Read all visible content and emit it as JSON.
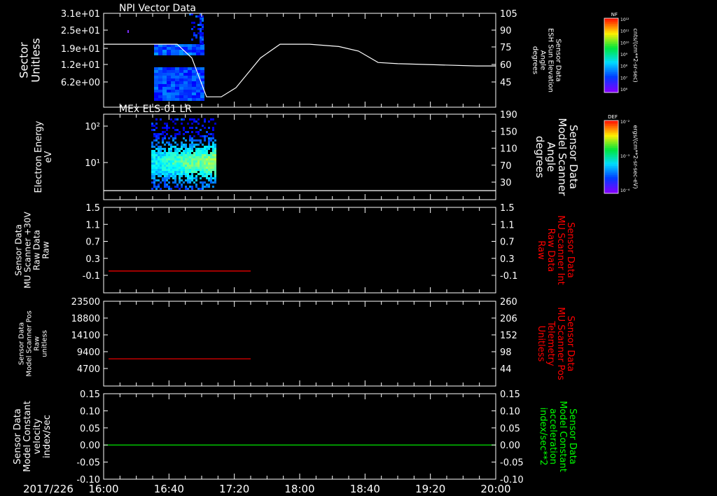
{
  "time_axis": {
    "date": "2017/226",
    "ticks": [
      "16:00",
      "16:40",
      "17:20",
      "18:00",
      "18:40",
      "19:20",
      "20:00"
    ],
    "range_hours": [
      16.0,
      20.0
    ]
  },
  "colorbars": [
    {
      "tag": "NF",
      "unit": "cnts/(cm**2-sr-sec)",
      "ticks": [
        "10¹²",
        "10¹¹",
        "10¹⁰",
        "10⁹",
        "10⁸",
        "10⁷",
        "10⁶"
      ],
      "scale": "log"
    },
    {
      "tag": "DEF",
      "unit": "ergs/(cm**2-sr-sec-eV)",
      "ticks": [
        "10⁻²",
        "10⁻³",
        "10⁻⁴"
      ],
      "scale": "log"
    }
  ],
  "chart_data": [
    {
      "type": "heatmap",
      "title": "NPI Vector Data",
      "ylabel": [
        "Sector",
        "Unitless"
      ],
      "yticks": [
        "3.1e+01",
        "2.5e+01",
        "1.9e+01",
        "1.2e+01",
        "6.2e+00"
      ],
      "ylim": [
        0,
        31
      ],
      "x_extent_hours": [
        16.5,
        17.0
      ],
      "y2label": [
        "Sensor Data",
        "ESH Sun Elevation",
        "Angle",
        "degrees"
      ],
      "y2ticks": [
        "105",
        "90",
        "75",
        "60",
        "45"
      ],
      "y2lim": [
        30,
        105
      ],
      "line": {
        "color": "#ffffff",
        "x": [
          16.0,
          16.75,
          16.9,
          17.05,
          17.2,
          17.35,
          17.6,
          17.8,
          18.1,
          18.4,
          18.6,
          18.8,
          19.0,
          19.4,
          19.8,
          20.0
        ],
        "y": [
          78,
          78,
          66,
          32,
          32,
          40,
          66,
          78,
          78,
          76,
          72,
          62,
          61,
          60,
          59,
          59
        ]
      }
    },
    {
      "type": "heatmap",
      "title": "MEx ELS-01 LR",
      "ylabel": [
        "Electron Energy",
        "eV"
      ],
      "yticks": [
        "10²",
        "10¹"
      ],
      "yscale": "log",
      "ylim": [
        1,
        200
      ],
      "x_extent_hours": [
        16.5,
        17.1
      ],
      "y2label": [
        "Sensor Data",
        "Model Scanner",
        "Angle",
        "degrees"
      ],
      "y2ticks": [
        "190",
        "150",
        "110",
        "70",
        "30"
      ],
      "y2lim": [
        10,
        190
      ],
      "line": {
        "color": "#ffffff",
        "x": [
          16.0,
          20.0
        ],
        "y": [
          10,
          10
        ]
      }
    },
    {
      "type": "line",
      "ylabel": [
        "Sensor Data",
        "MU Scanner +30V",
        "Raw Data",
        "Raw"
      ],
      "yticks": [
        "1.5",
        "1.1",
        "0.7",
        "0.3",
        "-0.1"
      ],
      "ylim": [
        -0.3,
        1.5
      ],
      "y2label": [
        "Sensor Data",
        "MU Scanner Int",
        "Raw Data",
        "Raw"
      ],
      "y2label_color": "#ff0000",
      "y2ticks": [
        "1.5",
        "1.1",
        "0.7",
        "0.3",
        "-0.1"
      ],
      "series": [
        {
          "color": "#ff0000",
          "x": [
            16.05,
            17.5
          ],
          "y": [
            0.0,
            0.0
          ]
        }
      ]
    },
    {
      "type": "line",
      "ylabel": [
        "Sensor Data",
        "Model Scanner Pos",
        "Raw",
        "unitless"
      ],
      "yticks": [
        "23500",
        "18800",
        "14100",
        "9400",
        "4700"
      ],
      "ylim": [
        0,
        23500
      ],
      "y2label": [
        "Sensor Data",
        "MU Scanner Pos",
        "Telemetry",
        "Unitless"
      ],
      "y2label_color": "#ff0000",
      "y2ticks": [
        "260",
        "206",
        "152",
        "98",
        "44"
      ],
      "series": [
        {
          "color": "#ff0000",
          "x": [
            16.05,
            17.5
          ],
          "y": [
            7400,
            7400
          ]
        }
      ]
    },
    {
      "type": "line",
      "ylabel": [
        "Sensor Data",
        "Model Constant",
        "velocity",
        "index/sec"
      ],
      "yticks": [
        "0.15",
        "0.10",
        "0.05",
        "0.00",
        "-0.05",
        "-0.10"
      ],
      "ylim": [
        -0.1,
        0.15
      ],
      "y2label": [
        "Sensor Data",
        "Model Constant",
        "acceleration",
        "index/sec**2"
      ],
      "y2label_color": "#00ff00",
      "y2ticks": [
        "0.15",
        "0.10",
        "0.05",
        "0.00",
        "-0.05",
        "-0.10"
      ],
      "series": [
        {
          "color": "#00ff00",
          "x": [
            16.0,
            20.0
          ],
          "y": [
            0.0,
            0.0
          ]
        }
      ]
    }
  ]
}
